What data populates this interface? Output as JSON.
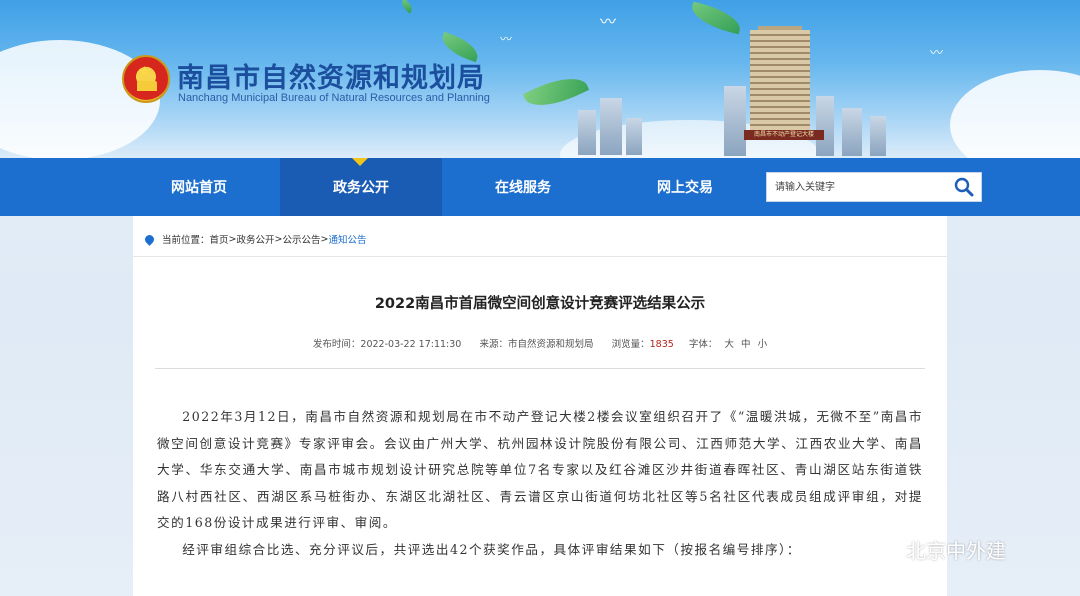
{
  "header": {
    "title": "南昌市自然资源和规划局",
    "subtitle": "Nanchang Municipal Bureau of Natural Resources and Planning",
    "tower_sign": "南昌市不动产登记大楼"
  },
  "nav": {
    "items": [
      {
        "label": "网站首页",
        "active": false
      },
      {
        "label": "政务公开",
        "active": true
      },
      {
        "label": "在线服务",
        "active": false
      },
      {
        "label": "网上交易",
        "active": false
      }
    ],
    "search_placeholder": "请输入关键字"
  },
  "breadcrumb": {
    "prefix": "当前位置：",
    "items": [
      "首页",
      "政务公开",
      "公示公告",
      "通知公告"
    ],
    "separator": ">"
  },
  "article": {
    "title": "2022南昌市首届微空间创意设计竞赛评选结果公示",
    "publish_label": "发布时间：",
    "publish_time": "2022-03-22 17:11:30",
    "source_label": "来源：",
    "source": "市自然资源和规划局",
    "views_label": "浏览量：",
    "views": "1835",
    "font_label": "字体：",
    "font_sizes": [
      "大",
      "中",
      "小"
    ],
    "paragraphs": [
      "2022年3月12日，南昌市自然资源和规划局在市不动产登记大楼2楼会议室组织召开了《“温暖洪城，无微不至”南昌市微空间创意设计竞赛》专家评审会。会议由广州大学、杭州园林设计院股份有限公司、江西师范大学、江西农业大学、南昌大学、华东交通大学、南昌市城市规划设计研究总院等单位7名专家以及红谷滩区沙井街道春晖社区、青山湖区站东街道铁路八村西社区、西湖区系马桩街办、东湖区北湖社区、青云谱区京山街道何坊北社区等5名社区代表成员组成评审组，对提交的168份设计成果进行评审、审阅。",
      "经评审组综合比选、充分评议后，共评选出42个获奖作品，具体评审结果如下（按报名编号排序）："
    ]
  },
  "watermark": {
    "text": "北京中外建"
  },
  "colors": {
    "nav_bg": "#1d6fcf",
    "nav_active": "#1a5cb3",
    "title_blue": "#1b4f9e",
    "views_red": "#b3251b",
    "accent_yellow": "#f0c419"
  }
}
